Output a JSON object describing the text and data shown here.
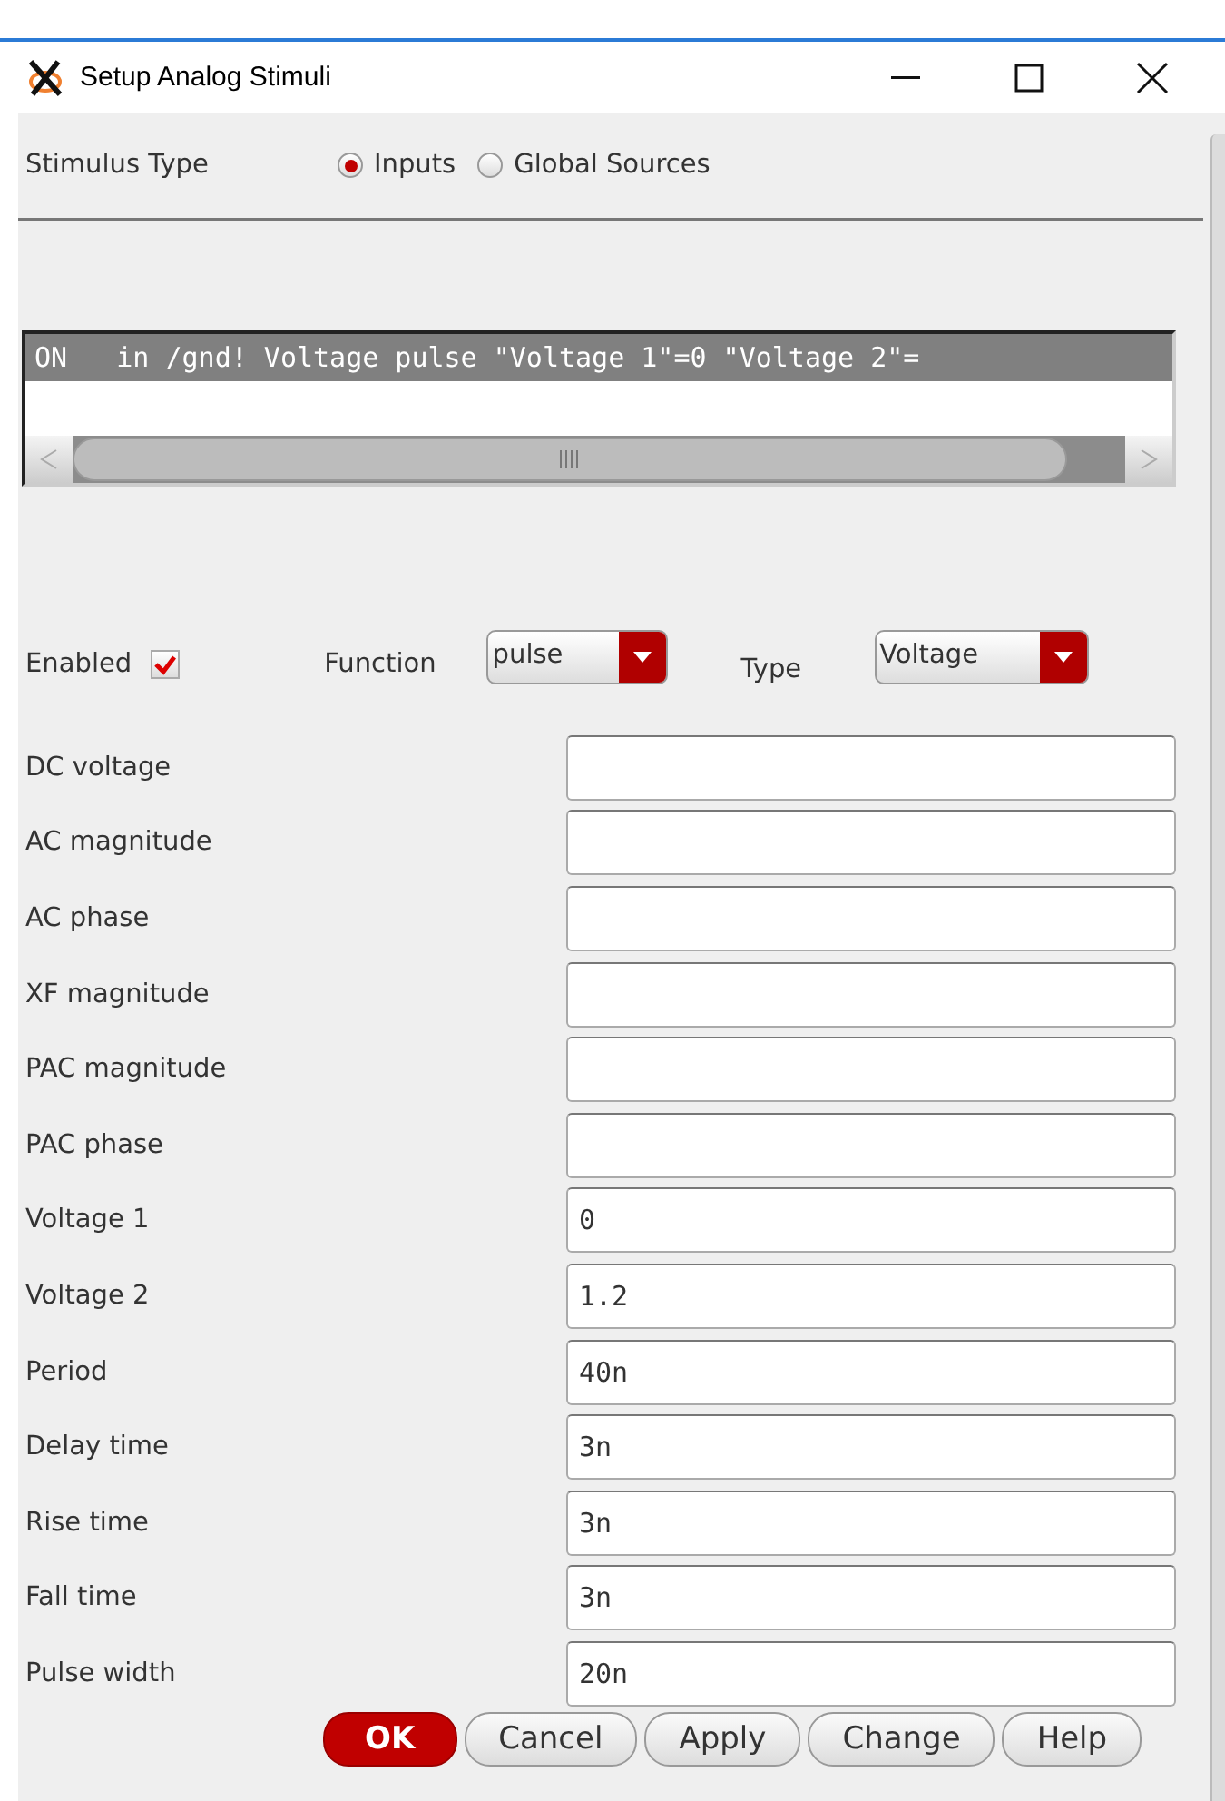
{
  "window": {
    "title": "Setup Analog Stimuli"
  },
  "stimulus_type": {
    "label": "Stimulus Type",
    "options": [
      {
        "label": "Inputs",
        "selected": true
      },
      {
        "label": "Global Sources",
        "selected": false
      }
    ]
  },
  "stimulus_list": {
    "rows": [
      {
        "text": "ON   in /gnd! Voltage pulse \"Voltage 1\"=0 \"Voltage 2\"=",
        "selected": true
      }
    ]
  },
  "enabled": {
    "label": "Enabled",
    "checked": true
  },
  "function": {
    "label": "Function",
    "value": "pulse"
  },
  "type": {
    "label": "Type",
    "value": "Voltage"
  },
  "fields": [
    {
      "label": "DC voltage"
    },
    {
      "label": "AC magnitude"
    },
    {
      "label": "AC phase"
    },
    {
      "label": "XF magnitude"
    },
    {
      "label": "PAC magnitude"
    },
    {
      "label": "PAC phase"
    },
    {
      "label": "Voltage 1",
      "value": "0"
    },
    {
      "label": "Voltage 2",
      "value": "1.2"
    },
    {
      "label": "Period",
      "value": "40n"
    },
    {
      "label": "Delay time",
      "value": "3n"
    },
    {
      "label": "Rise time",
      "value": "3n"
    },
    {
      "label": "Fall time",
      "value": "3n"
    },
    {
      "label": "Pulse width",
      "value": "20n"
    }
  ],
  "buttons": [
    {
      "label": "OK",
      "kind": "primary"
    },
    {
      "label": "Cancel",
      "kind": "normal"
    },
    {
      "label": "Apply",
      "kind": "normal"
    },
    {
      "label": "Change",
      "kind": "normal"
    },
    {
      "label": "Help",
      "kind": "normal"
    }
  ]
}
